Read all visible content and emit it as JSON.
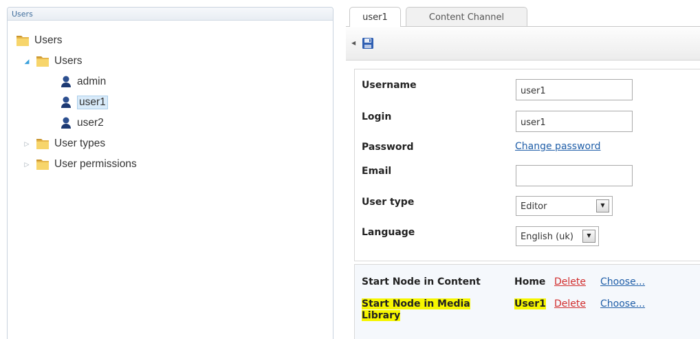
{
  "left_panel": {
    "header": "Users",
    "tree": {
      "root": "Users",
      "users_folder": "Users",
      "users": [
        "admin",
        "user1",
        "user2"
      ],
      "user_types": "User types",
      "user_permissions": "User permissions"
    },
    "selected_user": "user1"
  },
  "tabs": [
    {
      "label": "user1",
      "active": true
    },
    {
      "label": "Content Channel",
      "active": false
    }
  ],
  "toolbar": {
    "save_icon": "save-icon",
    "collapse_icon": "arrow-left-icon"
  },
  "form": {
    "username": {
      "label": "Username",
      "value": "user1"
    },
    "login": {
      "label": "Login",
      "value": "user1"
    },
    "password": {
      "label": "Password",
      "link": "Change password"
    },
    "email": {
      "label": "Email",
      "value": ""
    },
    "user_type": {
      "label": "User type",
      "selected": "Editor"
    },
    "language": {
      "label": "Language",
      "selected": "English (uk)"
    }
  },
  "start_nodes": {
    "content": {
      "label": "Start Node in Content",
      "value": "Home",
      "delete": "Delete",
      "choose": "Choose..."
    },
    "media": {
      "label": "Start Node in Media Library",
      "value": "User1",
      "delete": "Delete",
      "choose": "Choose..."
    }
  },
  "colors": {
    "link": "#1f5ea8",
    "delete": "#d12d2d",
    "highlight": "#f6f600",
    "selection": "#d9ebfa"
  }
}
